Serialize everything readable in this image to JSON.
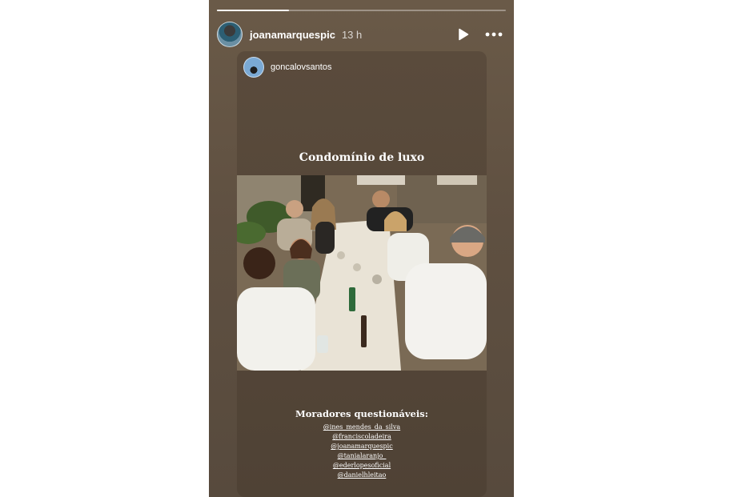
{
  "story": {
    "progress_fraction": 0.25,
    "author": {
      "username": "joanamarquespic",
      "time": "13 h"
    },
    "controls": {
      "play_icon": "play-icon",
      "more_icon": "more-dots-icon"
    },
    "reshare": {
      "username": "goncalovsantos",
      "caption_title": "Condomínio de luxo",
      "photo_description_icon": "group-dinner-photo",
      "tags_heading": "Moradores questionáveis:",
      "mentions": [
        "@ines_mendes_da_silva",
        "@franciscoladeira",
        "@joanamarquespic",
        "@tanialaranjo_",
        "@ederlopesoficial",
        "@danielhleitao"
      ]
    }
  }
}
